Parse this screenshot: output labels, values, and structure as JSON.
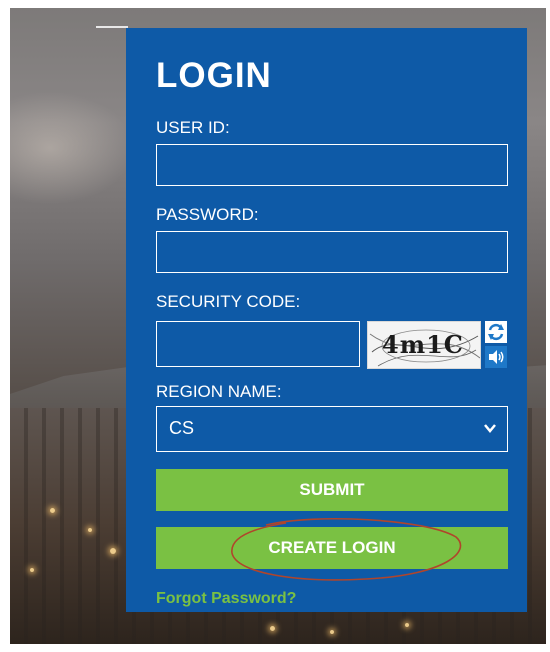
{
  "login": {
    "title": "LOGIN",
    "user_id_label": "USER ID:",
    "user_id_value": "",
    "password_label": "PASSWORD:",
    "password_value": "",
    "security_code_label": "SECURITY CODE:",
    "security_code_value": "",
    "captcha_text": "4m1C",
    "region_label": "REGION NAME:",
    "region_selected": "CS",
    "submit_label": "SUBMIT",
    "create_login_label": "CREATE LOGIN",
    "forgot_password_label": "Forgot Password?"
  },
  "icons": {
    "refresh": "refresh-icon",
    "audio": "speaker-icon",
    "dropdown": "chevron-down-icon"
  },
  "colors": {
    "panel": "#0e5aa7",
    "button": "#7ac143",
    "link": "#7ac143",
    "annotation": "#b0452b"
  }
}
